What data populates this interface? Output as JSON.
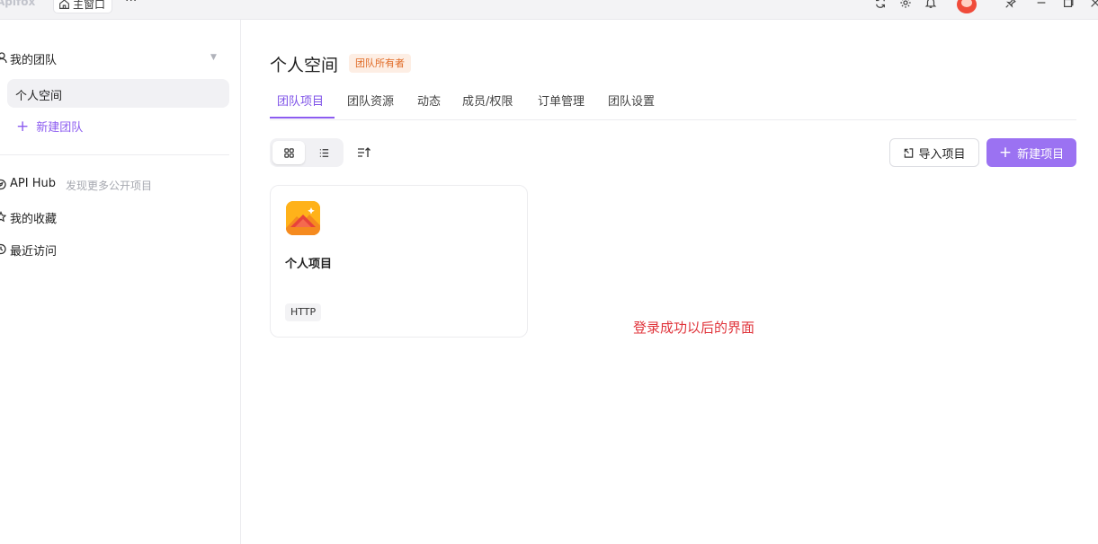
{
  "titlebar": {
    "app_name": "Apifox",
    "home_tab_label": "主窗口",
    "more_label": "···",
    "icons": [
      "refresh-icon",
      "gear-icon",
      "bell-icon",
      "avatar",
      "pin-icon",
      "minimize-icon",
      "restore-icon",
      "close-icon"
    ]
  },
  "sidebar": {
    "team_label": "我的团队",
    "space_label": "个人空间",
    "new_team_label": "新建团队",
    "nav": [
      {
        "label": "API Hub",
        "hint": "发现更多公开项目"
      },
      {
        "label": "我的收藏"
      },
      {
        "label": "最近访问"
      }
    ]
  },
  "main": {
    "title": "个人空间",
    "owner_badge": "团队所有者",
    "tabs": [
      {
        "label": "团队项目",
        "active": true
      },
      {
        "label": "团队资源"
      },
      {
        "label": "动态"
      },
      {
        "label": "成员/权限"
      },
      {
        "label": "订单管理"
      },
      {
        "label": "团队设置"
      }
    ],
    "import_label": "导入项目",
    "create_label": "新建项目",
    "projects": [
      {
        "name": "个人项目",
        "tag": "HTTP"
      }
    ],
    "note": "登录成功以后的界面"
  },
  "colors": {
    "accent": "#8c5cf0",
    "primary_button": "#9b72f2",
    "badge_bg": "#fdeee4",
    "badge_text": "#e06a25",
    "note_text": "#e0343b"
  }
}
